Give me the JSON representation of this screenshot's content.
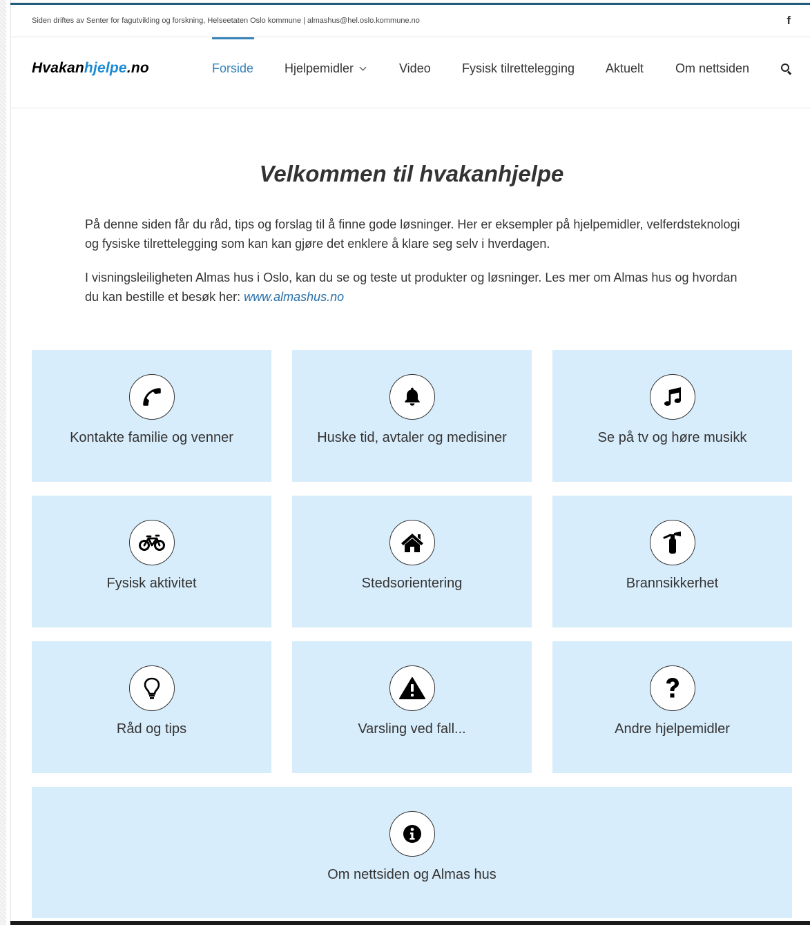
{
  "topbar": {
    "info_text": "Siden driftes av Senter for fagutvikling og forskning, Helseetaten Oslo kommune  |  almashus@hel.oslo.kommune.no",
    "facebook_icon": "facebook-icon"
  },
  "header": {
    "logo_part1": "Hvakan",
    "logo_part2": "hjelpe",
    "logo_part3": ".no",
    "nav": {
      "forside": "Forside",
      "hjelpemidler": "Hjelpemidler",
      "video": "Video",
      "fysisk": "Fysisk tilrettelegging",
      "aktuelt": "Aktuelt",
      "om": "Om nettsiden"
    },
    "search_icon": "search-icon"
  },
  "main": {
    "title": "Velkommen til hvakanhjelpe",
    "intro1": "På denne siden får du råd, tips og forslag til å finne gode løsninger. Her er eksempler på hjelpemidler, velferdsteknologi og fysiske tilrettelegging som kan kan gjøre det enklere å klare seg selv i hverdagen.",
    "intro2_text": "I visningsleiligheten Almas hus i Oslo, kan du se og teste ut produkter og løsninger. Les mer om Almas hus og hvordan du kan bestille et besøk her: ",
    "intro2_link": "www.almashus.no"
  },
  "tiles": {
    "t1": "Kontakte familie og venner",
    "t2": "Huske tid, avtaler og medisiner",
    "t3": "Se på tv og høre musikk",
    "t4": "Fysisk aktivitet",
    "t5": "Stedsorientering",
    "t6": "Brannsikkerhet",
    "t7": "Råd og tips",
    "t8": "Varsling ved fall...",
    "t9": "Andre hjelpemidler",
    "t10": "Om nettsiden og Almas hus"
  },
  "colors": {
    "accent": "#3582b8",
    "tile_background": "#d8edfb",
    "top_border": "#1f5a7a",
    "logo_blue": "#1b8ad3"
  }
}
